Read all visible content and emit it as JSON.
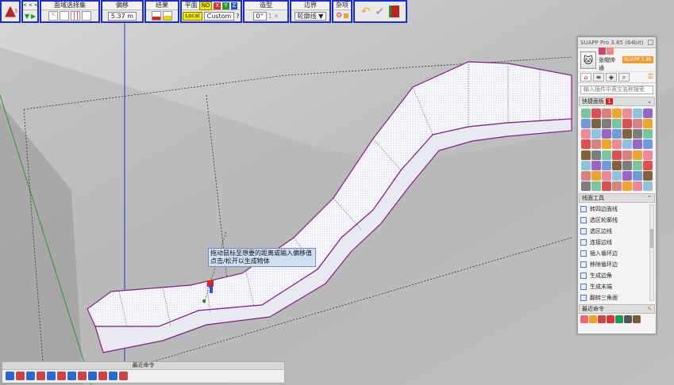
{
  "toolbar": {
    "main_badge": "3",
    "nav_label": "< < <",
    "face_select": {
      "title": "面域选择集"
    },
    "offset": {
      "title": "偏移",
      "value": "5.37 m"
    },
    "result": {
      "title": "结果"
    },
    "plane": {
      "title": "平面",
      "no_tag": "NO",
      "x": "X",
      "y": "Y",
      "z": "Z",
      "local_label": "Local",
      "custom_label": "Custom",
      "help": "?"
    },
    "shape": {
      "title": "造型",
      "angle": "0°",
      "num": "1"
    },
    "boundary": {
      "title": "边界",
      "select_value": "轮廓线"
    },
    "misc": {
      "title": "杂项"
    }
  },
  "tooltip": {
    "line1": "拖动鼠标至想要的距离或输入偏移值",
    "line2": "点击/松开以生成物体"
  },
  "panel": {
    "title": "SUAPP Pro 3.85 (64bit)",
    "user_name": "张帽帅通",
    "version_badge": "SUAPP 3.85",
    "search_placeholder": "输入插件中英文名称搜索",
    "quick_panel_label": "快捷面板",
    "quick_panel_count": "1",
    "line_tools_label": "线面工具",
    "line_tools": [
      "转四边面线",
      "选区轮廓线",
      "选区边线",
      "连接边线",
      "插入循环边",
      "移除循环边",
      "生成边角",
      "生成末端",
      "翻转三角面"
    ],
    "recent_label": "最近命令"
  },
  "minibar": {
    "title": "最近命令"
  },
  "colors": {
    "accent": "#1a2fc9",
    "selection_edge": "#8a1a8a",
    "orange": "#f5a524"
  }
}
